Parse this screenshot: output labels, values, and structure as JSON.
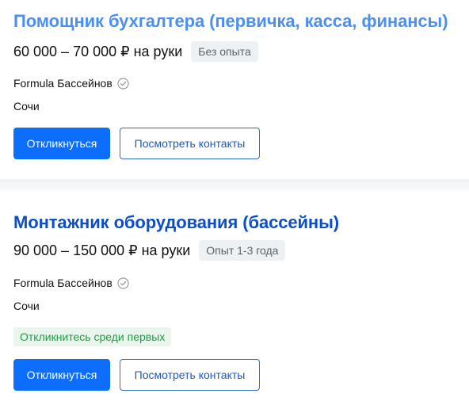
{
  "vacancies": [
    {
      "title": "Помощник бухгалтера (первичка, касса, финансы)",
      "salary": "60 000 – 70 000 ₽ на руки",
      "experience": "Без опыта",
      "company": "Formula Бассейнов",
      "city": "Сочи",
      "respond_label": "Откликнуться",
      "contacts_label": "Посмотреть контакты"
    },
    {
      "title": "Монтажник оборудования (бассейны)",
      "salary": "90 000 – 150 000 ₽ на руки",
      "experience": "Опыт 1-3 года",
      "company": "Formula Бассейнов",
      "city": "Сочи",
      "hint": "Откликнитесь среди первых",
      "respond_label": "Откликнуться",
      "contacts_label": "Посмотреть контакты"
    }
  ],
  "colors": {
    "primary_button": "#0d6efd",
    "title_visited": "#4b8ff0",
    "title": "#0a4fc9",
    "hint_text": "#1f9d46",
    "hint_bg": "#e8f6ec"
  },
  "icons": {
    "verified": "check-circle-icon"
  }
}
